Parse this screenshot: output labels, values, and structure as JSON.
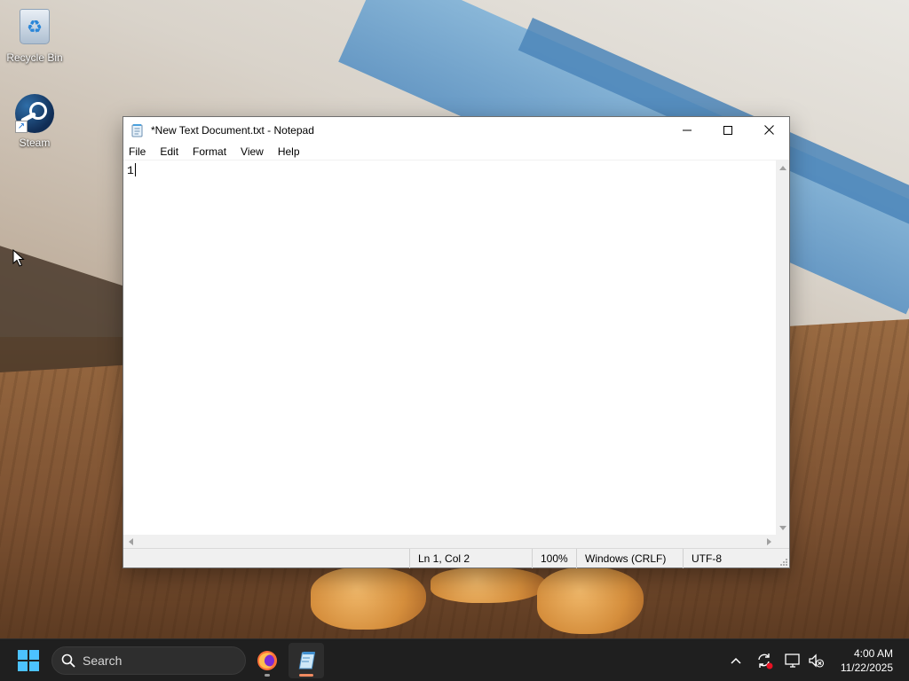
{
  "desktop": {
    "icons": [
      {
        "label": "Recycle Bin",
        "icon": "recycle-bin-icon"
      },
      {
        "label": "Steam",
        "icon": "steam-icon"
      }
    ]
  },
  "notepad": {
    "title": "*New Text Document.txt - Notepad",
    "menu": [
      "File",
      "Edit",
      "Format",
      "View",
      "Help"
    ],
    "content": "1",
    "status": {
      "position": "Ln 1, Col 2",
      "zoom": "100%",
      "line_ending": "Windows (CRLF)",
      "encoding": "UTF-8"
    }
  },
  "taskbar": {
    "search_label": "Search",
    "apps": [
      {
        "name": "Firefox",
        "icon": "firefox-icon",
        "active": false
      },
      {
        "name": "Notepad",
        "icon": "notepad-icon",
        "active": true
      }
    ],
    "clock": {
      "time": "4:00 AM",
      "date": "11/22/2025"
    }
  },
  "colors": {
    "taskbar_bg": "#1f1f1f",
    "active_indicator": "#f08a60",
    "win_blue": "#4cc2ff",
    "notification_red": "#e81123"
  }
}
